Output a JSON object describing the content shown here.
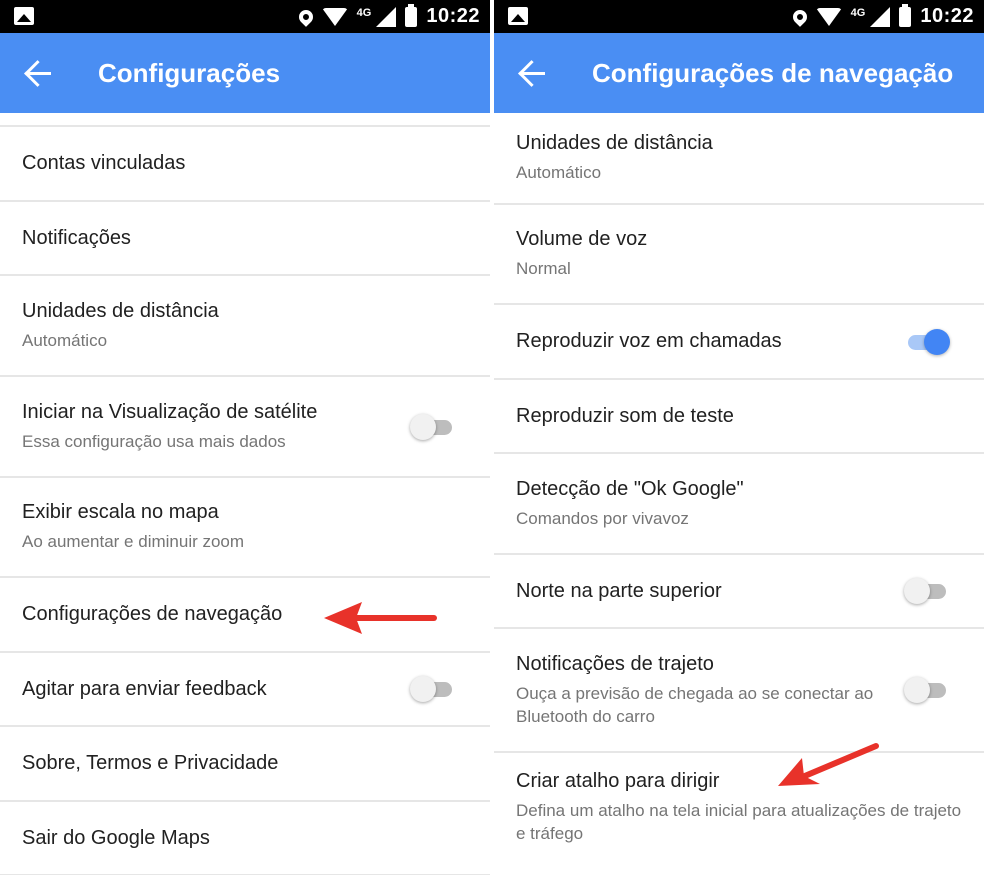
{
  "status_bar": {
    "time": "10:22",
    "network": "4G"
  },
  "left_screen": {
    "title": "Configurações",
    "items": [
      {
        "title": "Contas vinculadas",
        "subtitle": ""
      },
      {
        "title": "Notificações",
        "subtitle": ""
      },
      {
        "title": "Unidades de distância",
        "subtitle": "Automático"
      },
      {
        "title": "Iniciar na Visualização de satélite",
        "subtitle": "Essa configuração usa mais dados",
        "toggle": false
      },
      {
        "title": "Exibir escala no mapa",
        "subtitle": "Ao aumentar e diminuir zoom"
      },
      {
        "title": "Configurações de navegação",
        "subtitle": ""
      },
      {
        "title": "Agitar para enviar feedback",
        "subtitle": "",
        "toggle": false
      },
      {
        "title": "Sobre, Termos e Privacidade",
        "subtitle": ""
      },
      {
        "title": "Sair do Google Maps",
        "subtitle": ""
      }
    ]
  },
  "right_screen": {
    "title": "Configurações de navegação",
    "items": [
      {
        "title": "Unidades de distância",
        "subtitle": "Automático"
      },
      {
        "title": "Volume de voz",
        "subtitle": "Normal"
      },
      {
        "title": "Reproduzir voz em chamadas",
        "subtitle": "",
        "toggle": true
      },
      {
        "title": "Reproduzir som de teste",
        "subtitle": ""
      },
      {
        "title": "Detecção de \"Ok Google\"",
        "subtitle": "Comandos por vivavoz"
      },
      {
        "title": "Norte na parte superior",
        "subtitle": "",
        "toggle": false
      },
      {
        "title": "Notificações de trajeto",
        "subtitle": "Ouça a previsão de chegada ao se conectar ao Bluetooth do carro",
        "toggle": false
      },
      {
        "title": "Criar atalho para dirigir",
        "subtitle": "Defina um atalho na tela inicial para atualizações de trajeto e tráfego"
      }
    ]
  },
  "colors": {
    "appbar": "#4a8ef3",
    "accent": "#4285f4",
    "annotation_arrow": "#e8322a"
  },
  "icons": {
    "back": "arrow-back-icon",
    "gallery": "gallery-icon",
    "location": "location-pin-icon",
    "wifi": "wifi-icon",
    "signal": "signal-icon",
    "battery": "battery-icon"
  }
}
